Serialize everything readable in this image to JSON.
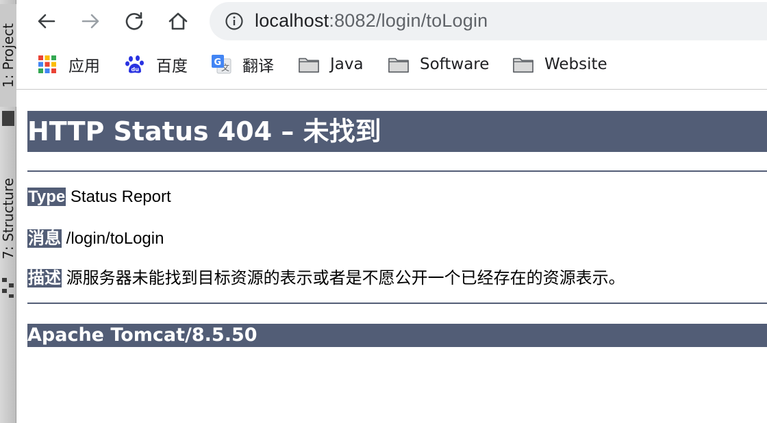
{
  "ide": {
    "project_tab": "1: Project",
    "structure_tab": "7: Structure"
  },
  "browser": {
    "url_host": "localhost",
    "url_path": ":8082/login/toLogin",
    "nav": {
      "back_icon": "arrow-left-icon",
      "forward_icon": "arrow-right-icon",
      "reload_icon": "reload-icon",
      "home_icon": "home-icon"
    },
    "bookmarks": [
      {
        "label": "应用",
        "icon": "apps-grid-icon"
      },
      {
        "label": "百度",
        "icon": "baidu-paw-icon"
      },
      {
        "label": "翻译",
        "icon": "google-translate-icon"
      },
      {
        "label": "Java",
        "icon": "folder-icon"
      },
      {
        "label": "Software",
        "icon": "folder-icon"
      },
      {
        "label": "Website",
        "icon": "folder-icon"
      }
    ]
  },
  "page": {
    "title": "HTTP Status 404 – 未找到",
    "type_label": "Type",
    "type_value": "Status Report",
    "message_label": "消息",
    "message_value": "/login/toLogin",
    "description_label": "描述",
    "description_value": "源服务器未能找到目标资源的表示或者是不愿公开一个已经存在的资源表示。",
    "footer": "Apache Tomcat/8.5.50"
  },
  "colors": {
    "header_bg": "#525d76",
    "omnibox_bg": "#eff1f3"
  }
}
